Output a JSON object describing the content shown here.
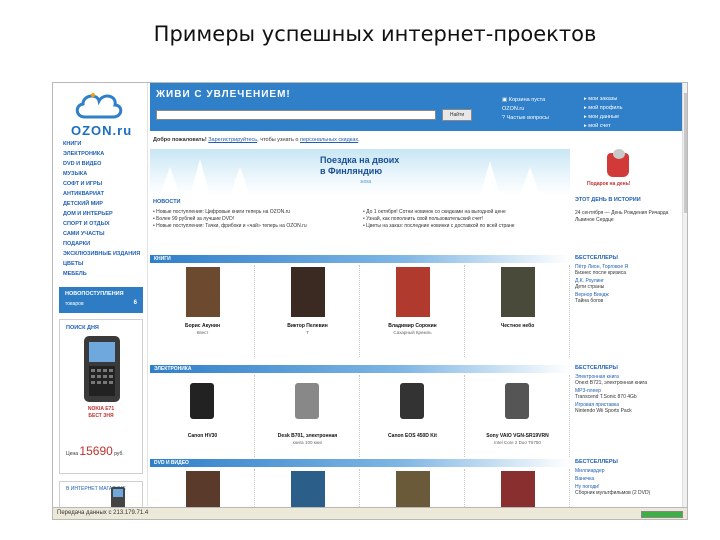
{
  "slide": {
    "title": "Примеры успешных интернет-проектов"
  },
  "header": {
    "slogan": "ЖИВИ С УВЛЕЧЕНИЕМ!",
    "search_value": "",
    "search_button": "Найти",
    "link_basket": "Корзина пуста",
    "link_faq": "Частые вопросы",
    "link_ozon": "OZON.ru",
    "right_links": [
      "мои заказы",
      "мой профиль",
      "мои данные",
      "мой счет"
    ]
  },
  "logo": {
    "text": "OZON.ru"
  },
  "categories": [
    "КНИГИ",
    "ЭЛЕКТРОНИКА",
    "DVD И ВИДЕО",
    "МУЗЫКА",
    "СОФТ И ИГРЫ",
    "АНТИКВАРИАТ",
    "ДЕТСКИЙ МИР",
    "ДОМ И ИНТЕРЬЕР",
    "СПОРТ И ОТДЫХ",
    "САМИ УЧАСТЫ",
    "ПОДАРКИ",
    "ЭКСКЛЮЗИВНЫЕ ИЗДАНИЯ",
    "ЦВЕТЫ",
    "МЕБЕЛЬ"
  ],
  "new_box": {
    "title": "НОВОПОСТУПЛЕНИЯ",
    "subtitle": "товаров",
    "count": "6"
  },
  "phone_promo": {
    "title": "ПОИСК ДНЯ",
    "line1": "NOKIA E71",
    "line2": "БЕСТ ЗНЯ",
    "price_label": "Цена",
    "price": "15690",
    "currency": "руб."
  },
  "phone_promo2": {
    "text": "В ИНТЕРНЕТ МАГАЗИНЕ"
  },
  "welcome": {
    "prefix": "Добро пожаловать!",
    "link1": "Зарегистрируйтесь",
    "middle": ", чтобы узнать о",
    "link2": "персональных скидках",
    "suffix": "."
  },
  "banner": {
    "line1": "Поездка на двоих",
    "line2": "в Финляндию",
    "sub": "зима"
  },
  "gift": {
    "text": "Подарок на день!"
  },
  "news": {
    "heading": "НОВОСТИ",
    "col1": [
      "Новые поступления: Цифровые книги теперь на OZON.ru",
      "Более 99 рублей за лучшие DVD!",
      "Новые поступления: Тачки, фрибоки и «чай» теперь на OZON.ru"
    ],
    "col2": [
      "До 1 октября! Сотни новинок со скидками на выгодной цене",
      "Узнай, как пополнить свой пользовательский счет!",
      "Цветы на заказ: последние новинки с доставкой по всей стране"
    ]
  },
  "events": {
    "title": "ЭТОТ ДЕНЬ В ИСТОРИИ",
    "item": "24 сентября — День Рождения Ричарда Львиное Сердце"
  },
  "sections": {
    "books": {
      "label": "КНИГИ",
      "products": [
        {
          "name": "Борис Акунин",
          "desc": "Квест"
        },
        {
          "name": "Виктор Пелевин",
          "desc": "Т"
        },
        {
          "name": "Владимир Сорокин",
          "desc": "Сахарный Кремль"
        },
        {
          "name": "Честное небо",
          "desc": ""
        }
      ]
    },
    "electronics": {
      "label": "ЭЛЕКТРОНИКА",
      "products": [
        {
          "name": "Canon HV30",
          "desc": ""
        },
        {
          "name": "Desk B701, электронная",
          "desc": "книга 100 книг"
        },
        {
          "name": "Canon EOS 450D Kit",
          "desc": ""
        },
        {
          "name": "Sony VAIO VGN-SR19VRN",
          "desc": "Intel Core 2 Duo T5750"
        }
      ]
    },
    "dvd": {
      "label": "DVD И ВИДЕО",
      "products": [
        {
          "name": "",
          "desc": ""
        },
        {
          "name": "",
          "desc": ""
        },
        {
          "name": "",
          "desc": ""
        },
        {
          "name": "",
          "desc": ""
        }
      ]
    }
  },
  "side_books": {
    "title": "БЕСТСЕЛЛЕРЫ",
    "items": [
      {
        "link": "Пётр Лион, Торговое Я",
        "text": "Бизнес после кризиса"
      },
      {
        "link": "Д.К. Роулинг",
        "text": "Дети страны"
      },
      {
        "link": "Вернор Виндж",
        "text": "Тайна богов"
      }
    ]
  },
  "side_electronics": {
    "title": "БЕСТСЕЛЛЕРЫ",
    "items": [
      {
        "link": "Электронная книга",
        "text": "Onext B721, электронная книга"
      },
      {
        "link": "MP3-плеер",
        "text": "Transcend T.Sonic 870 4Gb"
      },
      {
        "link": "Игровая приставка",
        "text": "Nintendo Wii Sports Pack"
      }
    ]
  },
  "side_dvd": {
    "title": "БЕСТСЕЛЛЕРЫ",
    "items": [
      {
        "link": "Миллиардер",
        "text": ""
      },
      {
        "link": "Ванечка",
        "text": ""
      },
      {
        "link": "Ну погоди!",
        "text": "Сборник мультфильмов (2 DVD)"
      }
    ]
  },
  "status": {
    "text": "Передача данных с 213.179.71.4"
  },
  "colors": {
    "brand": "#2f7fc9",
    "link": "#1e5fb4",
    "accent_red": "#c03030"
  }
}
